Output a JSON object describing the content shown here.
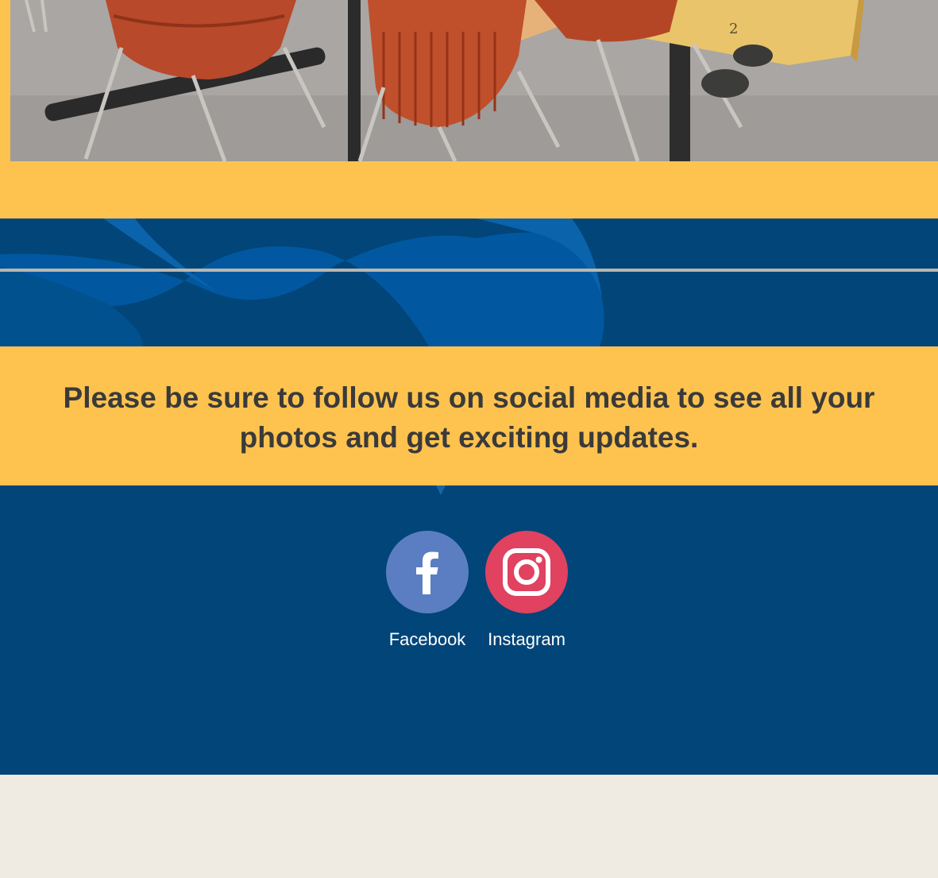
{
  "photo": {
    "icon": "classroom-photo",
    "table_number": "2"
  },
  "message": {
    "text": "Please be sure to follow us on social media to see all your photos and get exciting updates."
  },
  "social": {
    "links": [
      {
        "label": "Facebook",
        "icon": "facebook-icon",
        "color": "#5b7ec2"
      },
      {
        "label": "Instagram",
        "icon": "instagram-icon",
        "color": "#e0425f"
      }
    ]
  },
  "colors": {
    "accent_yellow": "#fec34f",
    "navy": "#014579",
    "text_dark": "#3a3a3a",
    "page_bg": "#efebe3"
  }
}
